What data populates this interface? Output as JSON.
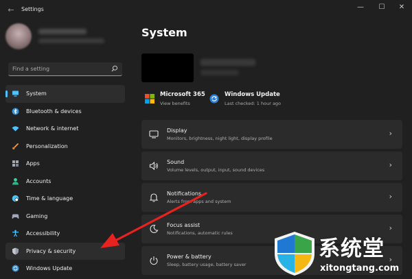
{
  "window": {
    "title": "Settings",
    "back_icon": "back-arrow-icon",
    "controls": {
      "minimize": "—",
      "maximize": "☐",
      "close": "✕"
    }
  },
  "search": {
    "placeholder": "Find a setting"
  },
  "nav": {
    "items": [
      {
        "label": "System",
        "icon": "monitor-icon",
        "color": "#4cc2ff",
        "active": true
      },
      {
        "label": "Bluetooth & devices",
        "icon": "bluetooth-icon",
        "color": "#4cc2ff"
      },
      {
        "label": "Network & internet",
        "icon": "wifi-icon",
        "color": "#4cc2ff"
      },
      {
        "label": "Personalization",
        "icon": "brush-icon",
        "color": "#f0a04b"
      },
      {
        "label": "Apps",
        "icon": "apps-icon",
        "color": "#a0a8b8"
      },
      {
        "label": "Accounts",
        "icon": "person-icon",
        "color": "#3fd0a0"
      },
      {
        "label": "Time & language",
        "icon": "globe-clock-icon",
        "color": "#4cc2ff"
      },
      {
        "label": "Gaming",
        "icon": "controller-icon",
        "color": "#a0a8b8"
      },
      {
        "label": "Accessibility",
        "icon": "accessibility-icon",
        "color": "#4cc2ff"
      },
      {
        "label": "Privacy & security",
        "icon": "shield-icon",
        "color": "#9aa0aa",
        "hover": true
      },
      {
        "label": "Windows Update",
        "icon": "update-icon",
        "color": "#4cc2ff"
      }
    ]
  },
  "main": {
    "title": "System",
    "quick": [
      {
        "title": "Microsoft 365",
        "sub": "View benefits",
        "icon": "microsoft-logo-icon"
      },
      {
        "title": "Windows Update",
        "sub": "Last checked: 1 hour ago",
        "icon": "update-icon"
      }
    ],
    "cards": [
      {
        "title": "Display",
        "sub": "Monitors, brightness, night light, display profile",
        "icon": "display-icon"
      },
      {
        "title": "Sound",
        "sub": "Volume levels, output, input, sound devices",
        "icon": "speaker-icon"
      },
      {
        "title": "Notifications",
        "sub": "Alerts from apps and system",
        "icon": "bell-icon"
      },
      {
        "title": "Focus assist",
        "sub": "Notifications, automatic rules",
        "icon": "moon-icon"
      },
      {
        "title": "Power & battery",
        "sub": "Sleep, battery usage, battery saver",
        "icon": "power-icon"
      }
    ]
  },
  "watermark": {
    "title": "系统堂",
    "site": "xitongtang.com"
  },
  "colors": {
    "accent": "#4cc2ff",
    "arrow": "#e8231f",
    "background": "#202020",
    "card": "#2b2b2b"
  }
}
